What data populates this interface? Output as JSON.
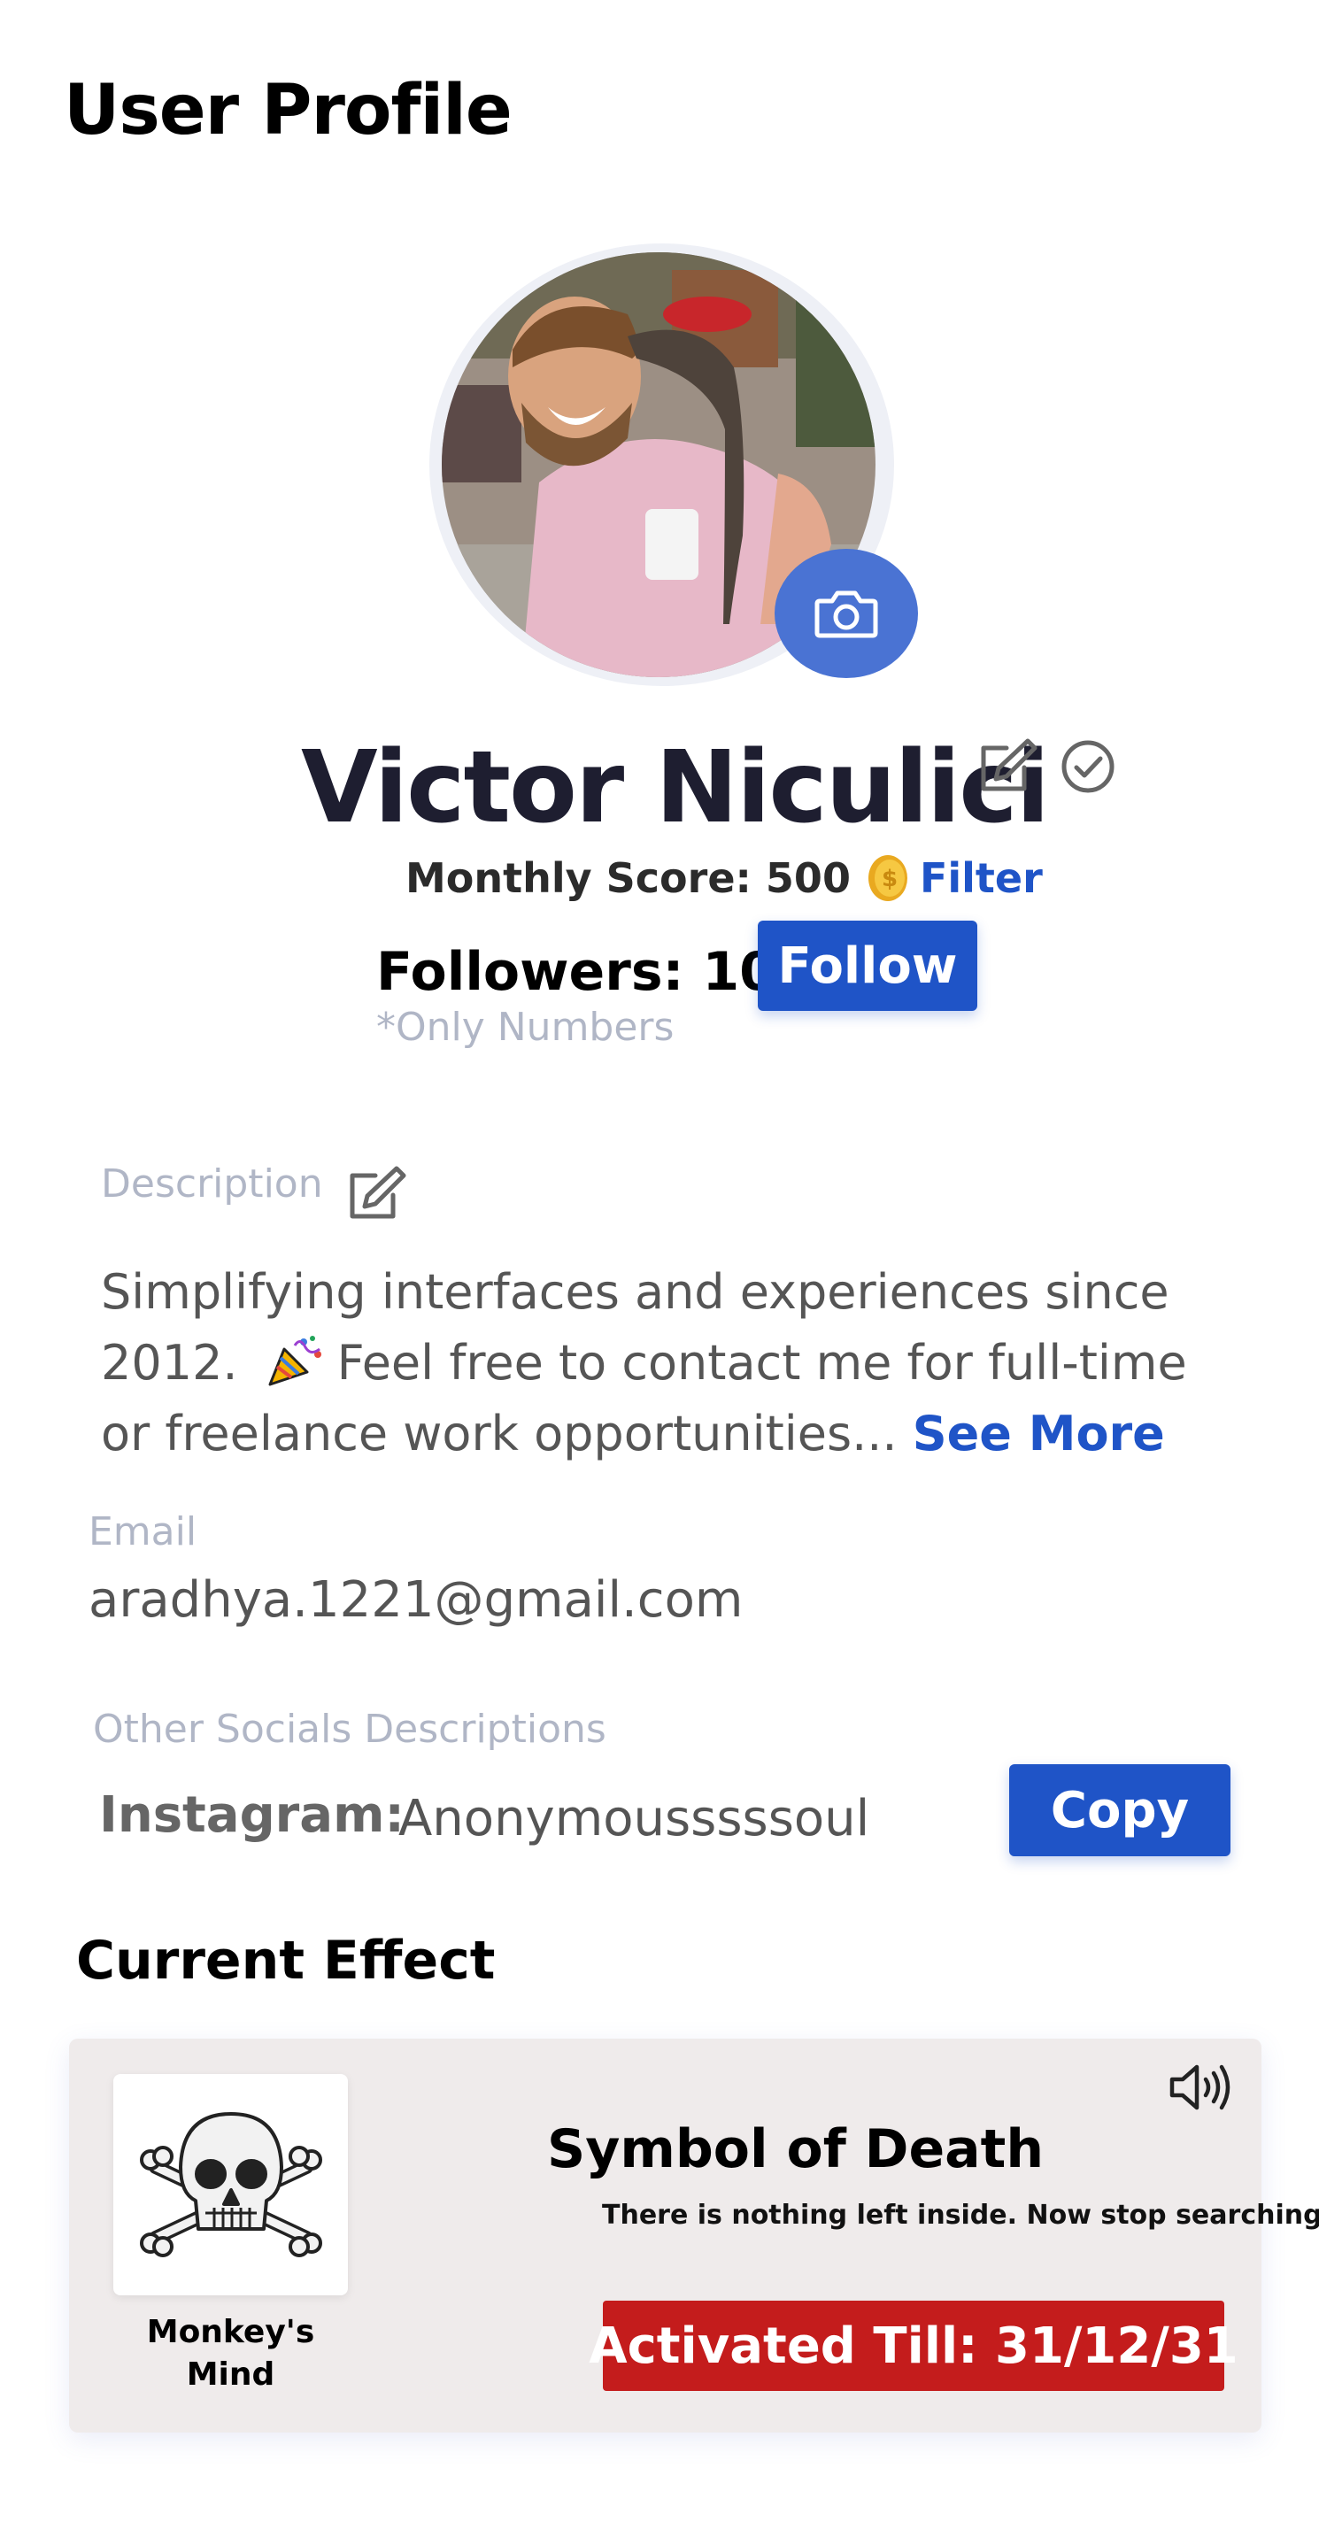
{
  "header": {
    "title": "User Profile"
  },
  "profile": {
    "name": "Victor Niculici",
    "monthly_score_label": "Monthly Score: 500",
    "filter_label": "Filter",
    "followers_label": "Followers: 10",
    "follow_button": "Follow",
    "followers_note": "*Only Numbers"
  },
  "description": {
    "label": "Description",
    "text_part1": "Simplifying interfaces and experiences since 2012.",
    "text_part2": "Feel free to contact me for full-time or freelance work opportunities...",
    "see_more": "See More"
  },
  "email": {
    "label": "Email",
    "value": "aradhya.1221@gmail.com"
  },
  "socials": {
    "label": "Other Socials Descriptions",
    "platform": "Instagram:",
    "handle": "Anonymousssssoul",
    "copy_button": "Copy"
  },
  "effect": {
    "heading": "Current Effect",
    "caption": "Monkey's Mind",
    "title": "Symbol of Death",
    "subtitle": "There is nothing left inside. Now stop searching.",
    "activated": "Activated Till: 31/12/31"
  },
  "colors": {
    "accent": "#1f54c7",
    "camera": "#4a73d3",
    "danger": "#c41c1c",
    "muted": "#b0b6c6"
  },
  "icons": [
    "camera-icon",
    "edit-icon",
    "check-circle-icon",
    "coin-icon",
    "party-popper-icon",
    "speaker-icon",
    "skull-crossbones-icon"
  ]
}
